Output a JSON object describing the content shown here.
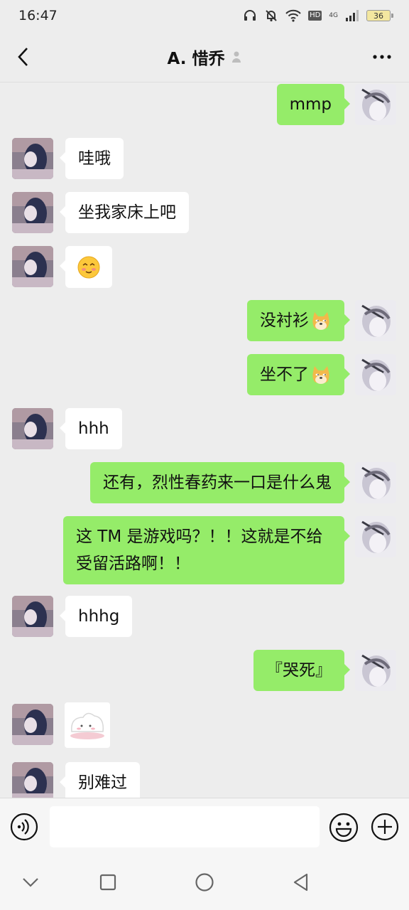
{
  "status_bar": {
    "time": "16:47",
    "hd_label": "HD",
    "network_label": "4G",
    "battery_level": "36"
  },
  "header": {
    "title": "A. 惜乔"
  },
  "messages": [
    {
      "side": "right",
      "text": "mmp"
    },
    {
      "side": "left",
      "text": "哇哦"
    },
    {
      "side": "left",
      "text": "坐我家床上吧"
    },
    {
      "side": "left",
      "emoji": "blushing-face-emoji"
    },
    {
      "side": "right",
      "text": "没衬衫",
      "emoji": "doge-emoji"
    },
    {
      "side": "right",
      "text": "坐不了",
      "emoji": "doge-emoji"
    },
    {
      "side": "left",
      "text": "hhh"
    },
    {
      "side": "right",
      "text": "还有，烈性春药来一口是什么鬼"
    },
    {
      "side": "right",
      "text": "这 TM 是游戏吗？！！这就是不给受留活路啊！！"
    },
    {
      "side": "left",
      "text": "hhhg"
    },
    {
      "side": "right",
      "text": "『哭死』"
    },
    {
      "side": "left",
      "sticker": "white-blob-sticker"
    },
    {
      "side": "left",
      "text": "别难过"
    }
  ],
  "input": {
    "value": "",
    "placeholder": ""
  },
  "colors": {
    "background": "#ededed",
    "bubble_self": "#95ec69",
    "bubble_other": "#ffffff"
  }
}
